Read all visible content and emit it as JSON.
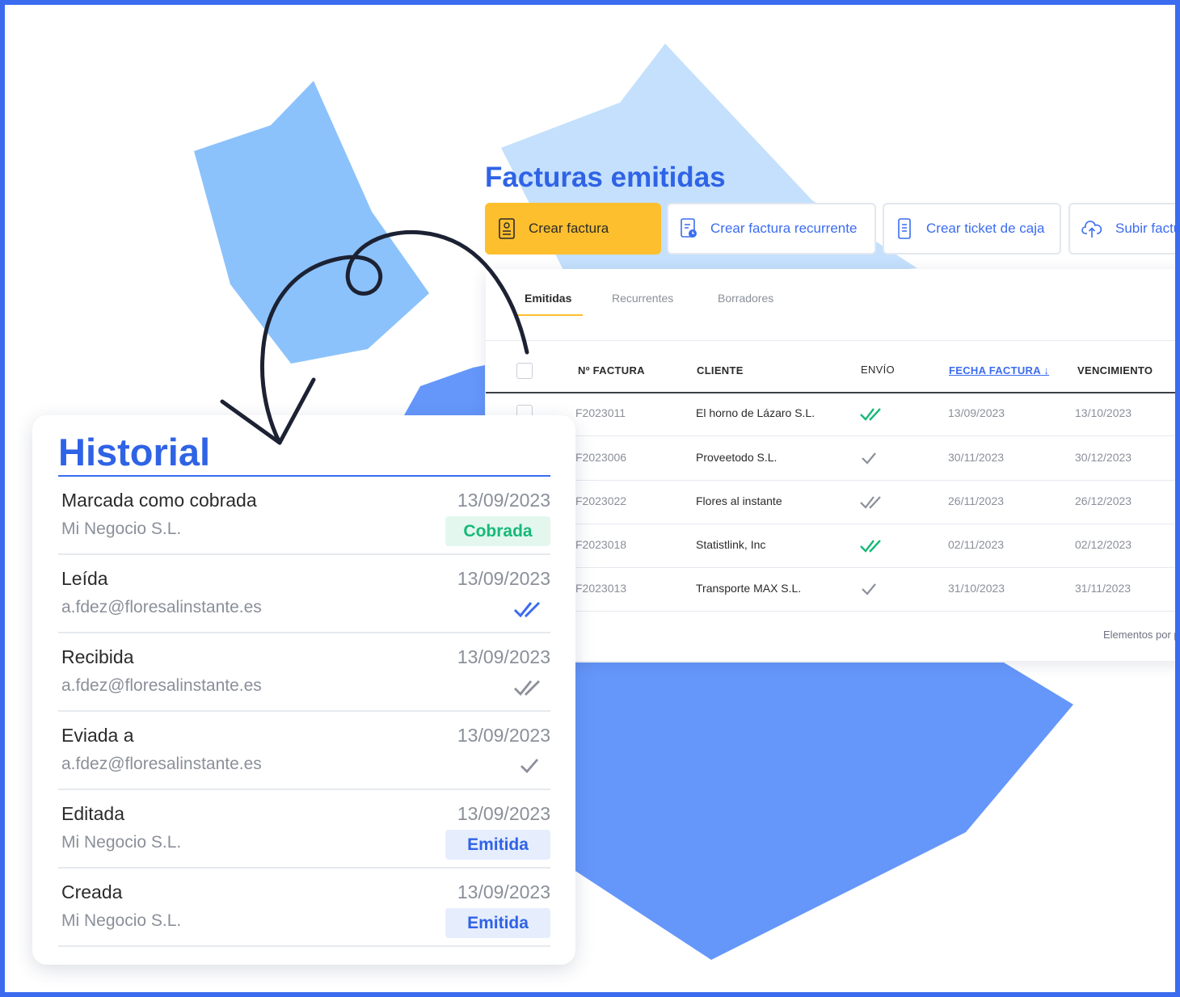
{
  "colors": {
    "accent": "#2f63e6",
    "primary_button": "#fdbf2d",
    "check_green": "#17b978",
    "check_blue": "#3b6cf0",
    "check_gray": "#8a8f99",
    "badge_green_bg": "#e3f7ee",
    "badge_blue_bg": "#e6edfd"
  },
  "invoices": {
    "title": "Facturas emitidas",
    "actions": [
      {
        "label": "Crear factura",
        "icon": "document-icon"
      },
      {
        "label": "Crear factura recurrente",
        "icon": "recurring-invoice-icon"
      },
      {
        "label": "Crear ticket de caja",
        "icon": "receipt-icon"
      },
      {
        "label": "Subir factura",
        "icon": "cloud-upload-icon"
      }
    ],
    "tabs": [
      "Emitidas",
      "Recurrentes",
      "Borradores"
    ],
    "columns": {
      "numero": "Nº FACTURA",
      "cliente": "CLIENTE",
      "envio": "ENVÍO",
      "fecha": "FECHA FACTURA ↓",
      "vencimiento": "VENCIMIENTO"
    },
    "rows": [
      {
        "numero": "F2023011",
        "cliente": "El horno de Lázaro S.L.",
        "envio": "double-check-green-icon",
        "fecha": "13/09/2023",
        "vencimiento": "13/10/2023"
      },
      {
        "numero": "F2023006",
        "cliente": "Proveetodo S.L.",
        "envio": "check-gray-icon",
        "fecha": "30/11/2023",
        "vencimiento": "30/12/2023"
      },
      {
        "numero": "F2023022",
        "cliente": "Flores al instante",
        "envio": "double-check-gray-icon",
        "fecha": "26/11/2023",
        "vencimiento": "26/12/2023"
      },
      {
        "numero": "F2023018",
        "cliente": "Statistlink, Inc",
        "envio": "double-check-green-icon",
        "fecha": "02/11/2023",
        "vencimiento": "02/12/2023"
      },
      {
        "numero": "F2023013",
        "cliente": "Transporte MAX S.L.",
        "envio": "check-gray-icon",
        "fecha": "31/10/2023",
        "vencimiento": "31/11/2023"
      }
    ],
    "footer": "Elementos por página"
  },
  "history": {
    "title": "Historial",
    "items": [
      {
        "label": "Marcada como cobrada",
        "date": "13/09/2023",
        "sub": "Mi Negocio S.L.",
        "badge": "Cobrada",
        "badge_color": "green"
      },
      {
        "label": "Leída",
        "date": "13/09/2023",
        "sub": "a.fdez@floresalinstante.es",
        "icon": "double-check-blue-icon"
      },
      {
        "label": "Recibida",
        "date": "13/09/2023",
        "sub": "a.fdez@floresalinstante.es",
        "icon": "double-check-gray-icon"
      },
      {
        "label": "Eviada a",
        "date": "13/09/2023",
        "sub": "a.fdez@floresalinstante.es",
        "icon": "check-gray-icon"
      },
      {
        "label": "Editada",
        "date": "13/09/2023",
        "sub": "Mi Negocio S.L.",
        "badge": "Emitida",
        "badge_color": "blue"
      },
      {
        "label": "Creada",
        "date": "13/09/2023",
        "sub": "Mi Negocio S.L.",
        "badge": "Emitida",
        "badge_color": "blue"
      }
    ]
  }
}
